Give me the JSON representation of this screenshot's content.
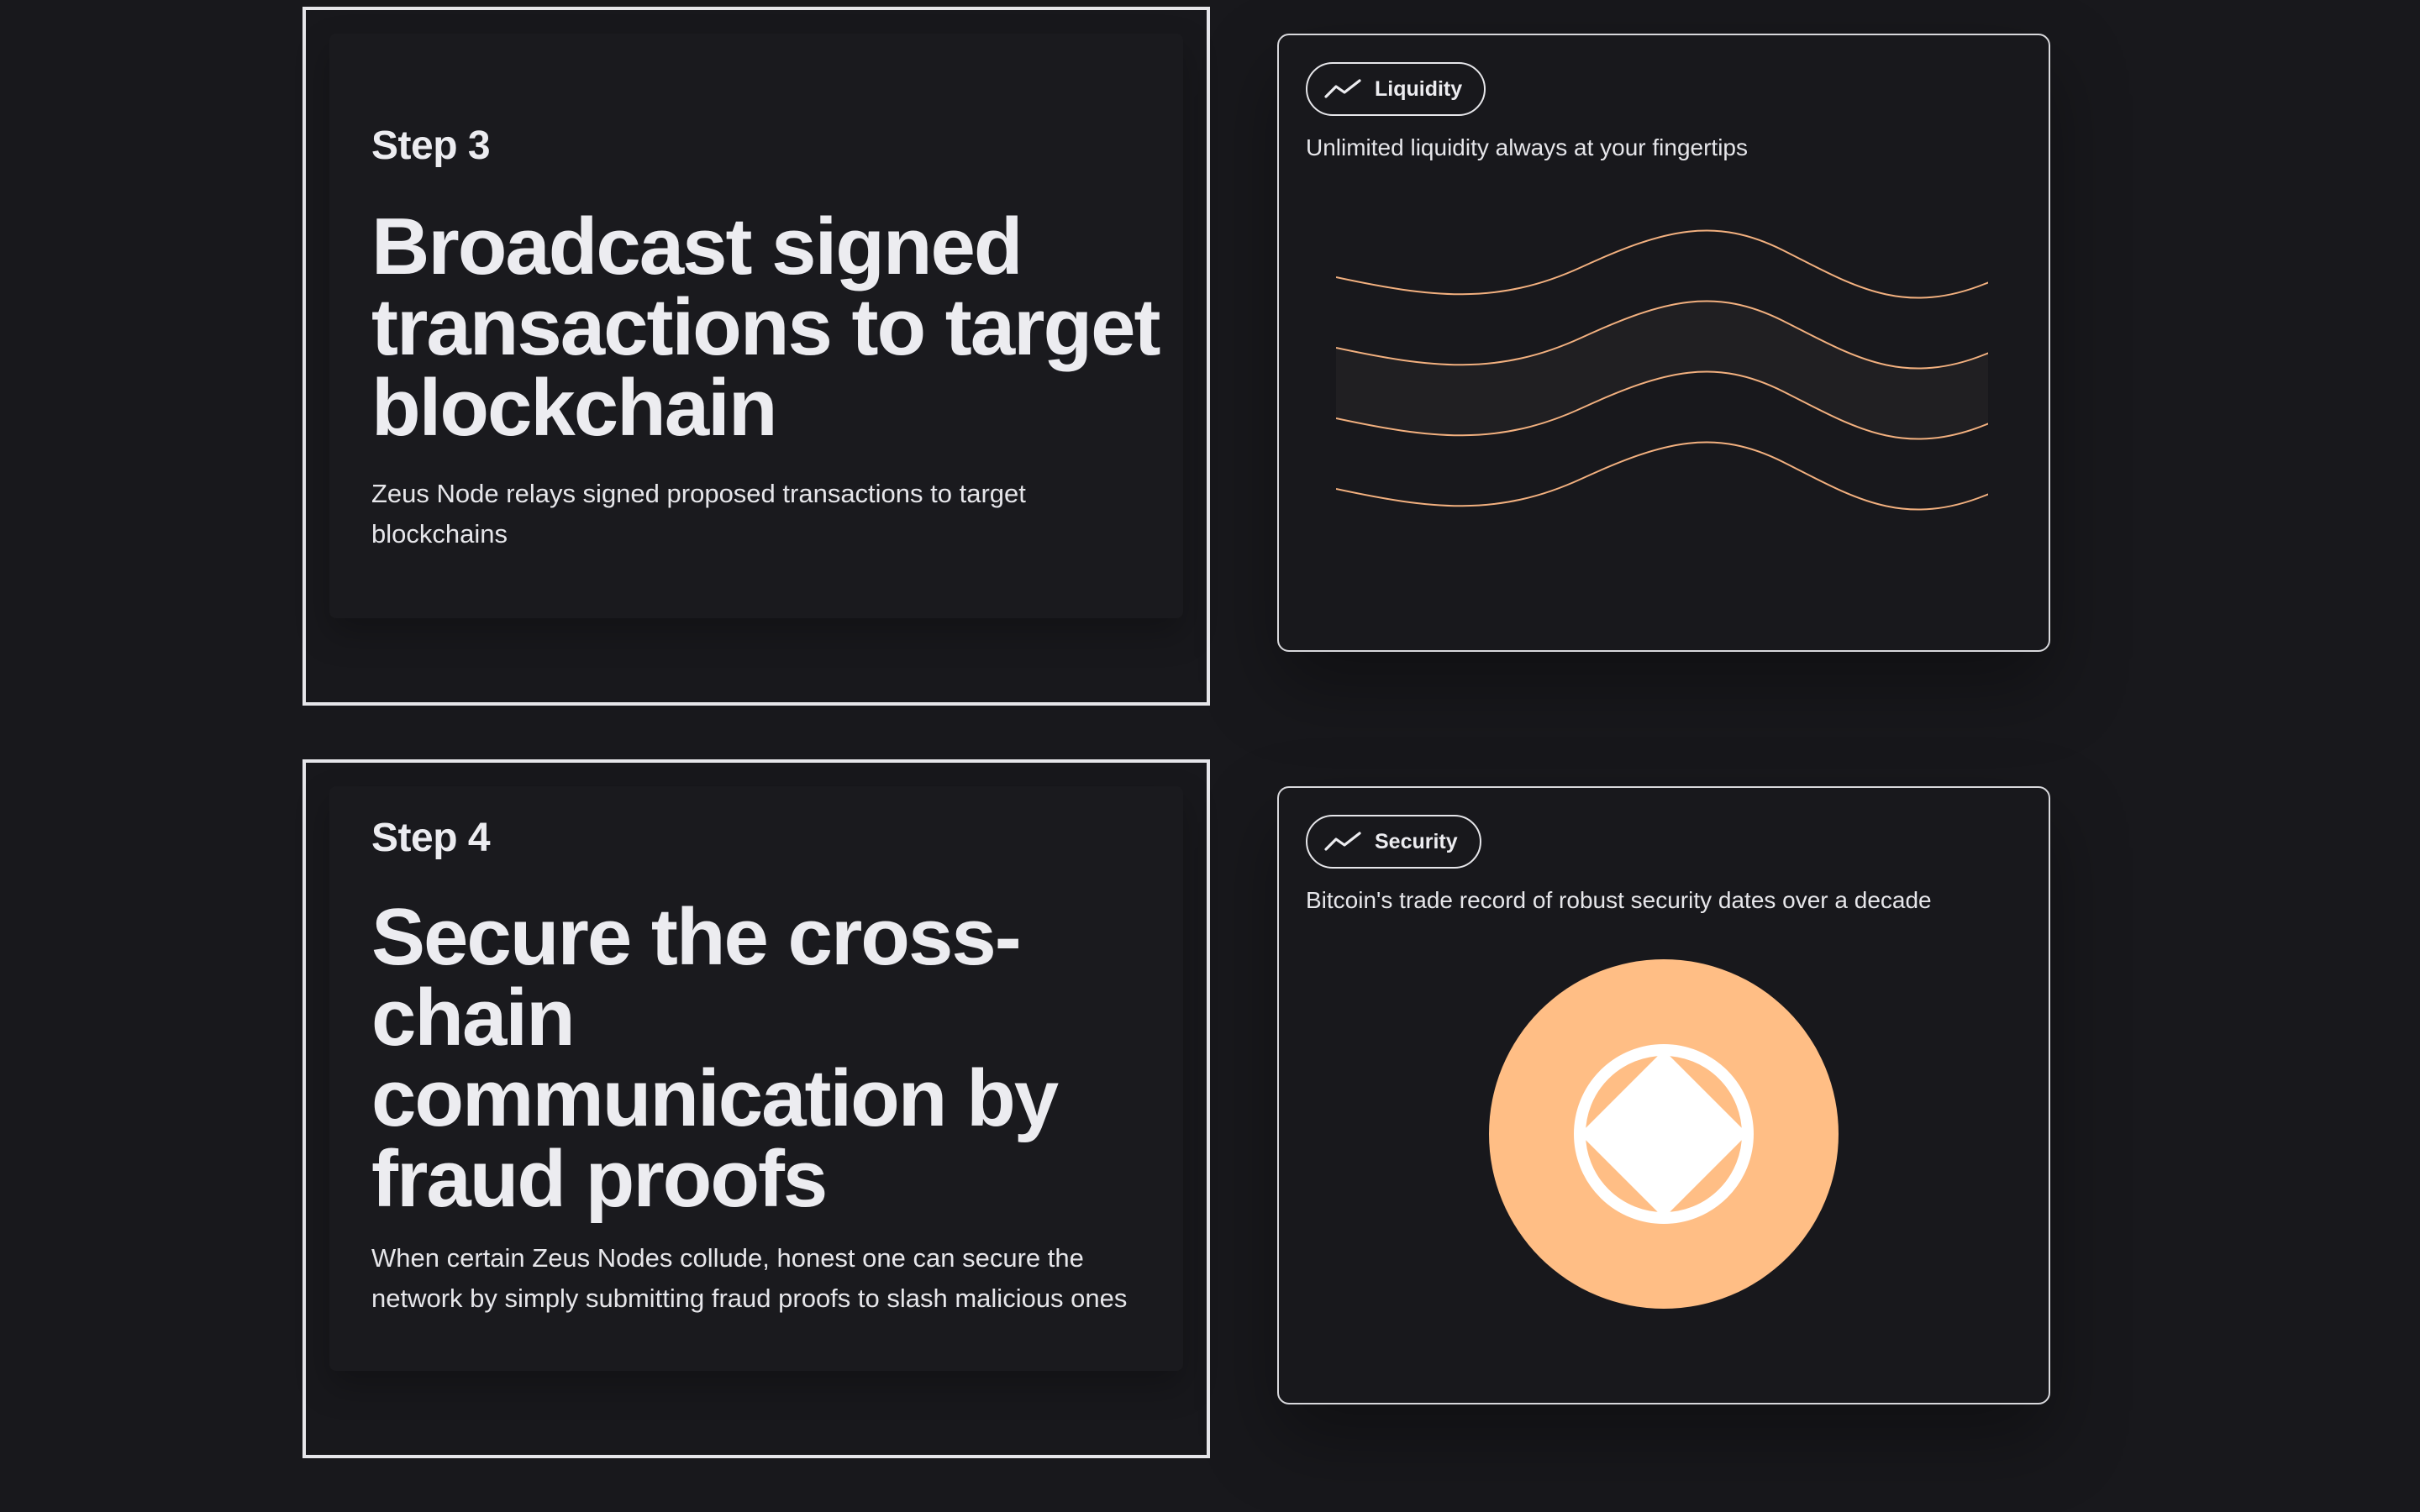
{
  "steps": [
    {
      "label": "Step 3",
      "title": "Broadcast signed transactions to target blockchain",
      "description": "Zeus Node relays signed proposed transactions to target blockchains"
    },
    {
      "label": "Step 4",
      "title": "Secure the cross-chain communication by fraud proofs",
      "description": "When certain Zeus Nodes collude, honest one can secure the network by simply submitting fraud proofs to slash malicious ones"
    }
  ],
  "features": [
    {
      "pill_label": "Liquidity",
      "icon": "trend-line-icon",
      "description": "Unlimited liquidity always at your fingertips",
      "illustration": "wave-lines"
    },
    {
      "pill_label": "Security",
      "icon": "trend-line-icon",
      "description": "Bitcoin's trade record of robust security dates over a decade",
      "illustration": "orange-coin-with-diamond"
    }
  ],
  "colors": {
    "background": "#18181c",
    "text": "#ececf0",
    "accent": "#ffbe85",
    "border": "#e6e6ea"
  }
}
